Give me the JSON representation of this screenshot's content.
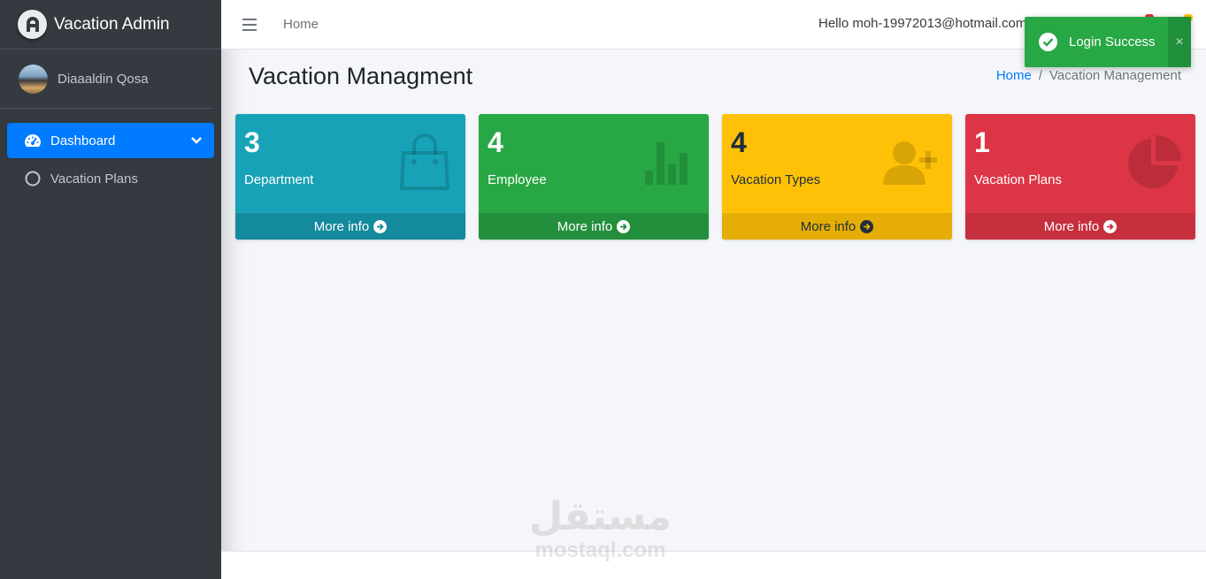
{
  "app": {
    "title": "Vacation Admin"
  },
  "sidebar": {
    "user_name": "Diaaaldin Qosa",
    "items": [
      {
        "label": "Dashboard",
        "icon": "tachometer-icon",
        "active": true
      },
      {
        "label": "Vacation Plans",
        "icon": "circle-icon",
        "active": false
      }
    ]
  },
  "topbar": {
    "home_link": "Home",
    "greeting": "Hello moh-19972013@hotmail.com"
  },
  "toast": {
    "message": "Login Success",
    "close": "×"
  },
  "content": {
    "title": "Vacation Managment",
    "breadcrumb": {
      "home": "Home",
      "separator": "/",
      "current": "Vacation Management"
    }
  },
  "boxes": [
    {
      "count": "3",
      "label": "Department",
      "footer": "More info",
      "icon": "shopping-bag-icon",
      "color": "#17a2b8"
    },
    {
      "count": "4",
      "label": "Employee",
      "footer": "More info",
      "icon": "bar-chart-icon",
      "color": "#28a745"
    },
    {
      "count": "4",
      "label": "Vacation Types",
      "footer": "More info",
      "icon": "user-plus-icon",
      "color": "#ffc107"
    },
    {
      "count": "1",
      "label": "Vacation Plans",
      "footer": "More info",
      "icon": "pie-chart-icon",
      "color": "#dc3545"
    }
  ],
  "watermark": {
    "arabic": "مستقل",
    "latin": "mostaql.com"
  }
}
